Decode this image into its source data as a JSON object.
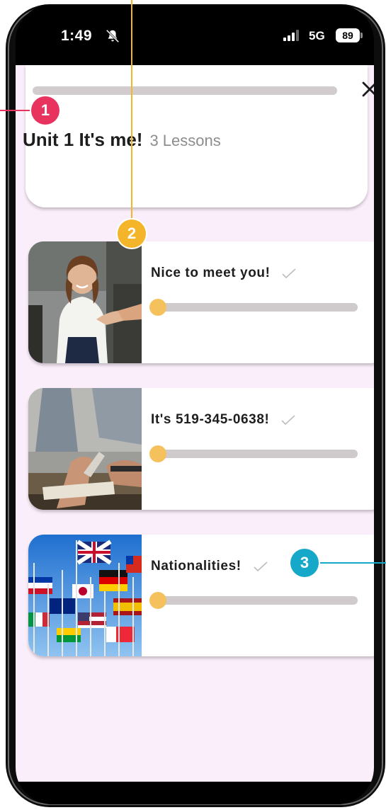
{
  "status_bar": {
    "time": "1:49",
    "network": "5G",
    "battery": "89"
  },
  "header": {
    "unit_title": "Unit 1 It's me!",
    "lesson_count": "3 Lessons",
    "progress": 0.0,
    "close_icon": "close-icon"
  },
  "lessons": [
    {
      "title": "Nice to meet you!",
      "progress": 0.0,
      "completed": false,
      "image": "handshake-photo"
    },
    {
      "title": "It's 519-345-0638!",
      "progress": 0.0,
      "completed": false,
      "image": "writing-phone-number-photo"
    },
    {
      "title": "Nationalities!",
      "progress": 0.0,
      "completed": false,
      "image": "world-flags-photo"
    }
  ],
  "callouts": [
    "1",
    "2",
    "3"
  ],
  "colors": {
    "background": "#fbeefb",
    "accent_yellow": "#f5c15c",
    "callout_pink": "#e8335f",
    "callout_yellow": "#f5b52a",
    "callout_teal": "#16a8c8",
    "track_gray": "#cfcacc"
  }
}
